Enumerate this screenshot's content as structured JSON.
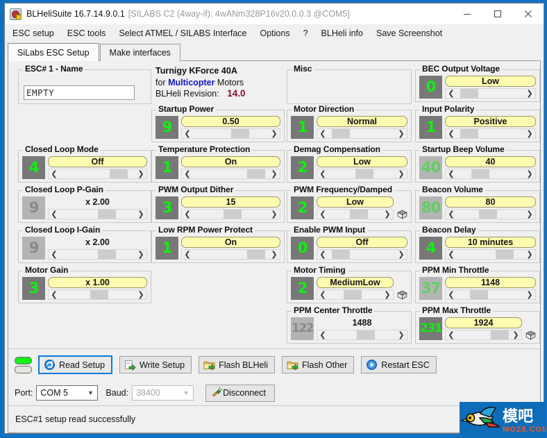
{
  "window": {
    "title": "BLHeliSuite 16.7.14.9.0.1",
    "subtitle": "[SILABS C2 (4way-if): 4wANm328P16v20.0.0.3 @COM5]",
    "minimize_label": "minimize",
    "maximize_label": "maximize",
    "close_label": "close"
  },
  "menu": [
    {
      "label": "ESC setup"
    },
    {
      "label": "ESC tools"
    },
    {
      "label": "Select ATMEL / SILABS Interface"
    },
    {
      "label": "Options"
    },
    {
      "label": "?"
    },
    {
      "label": "BLHeli info"
    },
    {
      "label": "Save Screenshot"
    }
  ],
  "tabs": [
    {
      "label": "SiLabs ESC Setup",
      "active": true
    },
    {
      "label": "Make interfaces",
      "active": false
    }
  ],
  "esc_name": {
    "title": "ESC# 1 - Name",
    "value": "EMPTY"
  },
  "esc_info": {
    "model": "Turnigy KForce 40A",
    "for_label": "for",
    "type": "Multicopter",
    "motors_label": "Motors",
    "revision_label": "BLHeli Revision:",
    "revision": "14.0"
  },
  "misc": {
    "title": "Misc"
  },
  "settings": [
    {
      "title": "Closed Loop Mode",
      "num": "4",
      "value": "Off",
      "thumb": 66,
      "dim": false,
      "yellow": true,
      "cube": false
    },
    {
      "title": "Closed Loop P-Gain",
      "num": "9",
      "value": "x 2.00",
      "thumb": 50,
      "dim": true,
      "yellow": false,
      "cube": false
    },
    {
      "title": "Closed Loop I-Gain",
      "num": "9",
      "value": "x 2.00",
      "thumb": 50,
      "dim": true,
      "yellow": false,
      "cube": false
    },
    {
      "title": "Motor Gain",
      "num": "3",
      "value": "x 1.00",
      "thumb": 40,
      "dim": false,
      "yellow": true,
      "cube": false
    },
    {
      "title": "Startup Power",
      "num": "9",
      "value": "0.50",
      "thumb": 50,
      "dim": false,
      "yellow": true,
      "cube": false
    },
    {
      "title": "Temperature Protection",
      "num": "1",
      "value": "On",
      "thumb": 72,
      "dim": false,
      "yellow": true,
      "cube": false
    },
    {
      "title": "PWM Output Dither",
      "num": "3",
      "value": "15",
      "thumb": 40,
      "dim": false,
      "yellow": true,
      "cube": false
    },
    {
      "title": "Low RPM Power Protect",
      "num": "1",
      "value": "On",
      "thumb": 72,
      "dim": false,
      "yellow": true,
      "cube": false
    },
    {
      "title": "Motor Direction",
      "num": "1",
      "value": "Normal",
      "thumb": 5,
      "dim": false,
      "yellow": true,
      "cube": false
    },
    {
      "title": "Demag Compensation",
      "num": "2",
      "value": "Low",
      "thumb": 40,
      "dim": false,
      "yellow": true,
      "cube": false
    },
    {
      "title": "PWM Frequency/Damped",
      "num": "2",
      "value": "Low",
      "thumb": 40,
      "dim": false,
      "yellow": true,
      "cube": true
    },
    {
      "title": "Enable PWM Input",
      "num": "0",
      "value": "Off",
      "thumb": 5,
      "dim": false,
      "yellow": true,
      "cube": false
    },
    {
      "title": "Motor Timing",
      "num": "2",
      "value": "MediumLow",
      "thumb": 28,
      "dim": false,
      "yellow": true,
      "cube": true
    },
    {
      "title": "PPM Center Throttle",
      "num": "122",
      "value": "1488",
      "thumb": 42,
      "dim": true,
      "yellow": false,
      "cube": false
    },
    {
      "title": "BEC Output Voltage",
      "num": "0",
      "value": "Low",
      "thumb": 5,
      "dim": false,
      "yellow": true,
      "cube": false
    },
    {
      "title": "Input Polarity",
      "num": "1",
      "value": "Positive",
      "thumb": 5,
      "dim": false,
      "yellow": true,
      "cube": false
    },
    {
      "title": "Startup Beep Volume",
      "num": "40",
      "value": "40",
      "thumb": 22,
      "dim": true,
      "yellow": true,
      "cube": false
    },
    {
      "title": "Beacon Volume",
      "num": "80",
      "value": "80",
      "thumb": 33,
      "dim": true,
      "yellow": true,
      "cube": false
    },
    {
      "title": "Beacon Delay",
      "num": "4",
      "value": "10 minutes",
      "thumb": 58,
      "dim": false,
      "yellow": true,
      "cube": false
    },
    {
      "title": "PPM Min Throttle",
      "num": "37",
      "value": "1148",
      "thumb": 20,
      "dim": true,
      "yellow": true,
      "cube": false
    },
    {
      "title": "PPM Max Throttle",
      "num": "231",
      "value": "1924",
      "thumb": 64,
      "dim": false,
      "yellow": true,
      "cube": true
    }
  ],
  "toolbar": {
    "led_top": "on",
    "led_bottom": "off",
    "buttons": [
      {
        "label": "Read Setup",
        "icon": "refresh-icon",
        "focused": true
      },
      {
        "label": "Write Setup",
        "icon": "write-icon",
        "focused": false
      },
      {
        "label": "Flash BLHeli",
        "icon": "folder-flash-icon",
        "focused": false
      },
      {
        "label": "Flash Other",
        "icon": "folder-flash-icon",
        "focused": false
      },
      {
        "label": "Restart ESC",
        "icon": "play-icon",
        "focused": false
      }
    ]
  },
  "portbar": {
    "port_label": "Port:",
    "port_value": "COM 5",
    "baud_label": "Baud:",
    "baud_value": "38400",
    "disconnect_label": "Disconnect"
  },
  "status": {
    "message": "ESC#1 setup read successfully"
  },
  "watermark": {
    "text_cn": "模吧",
    "text_url": "MOZ8.COM"
  }
}
